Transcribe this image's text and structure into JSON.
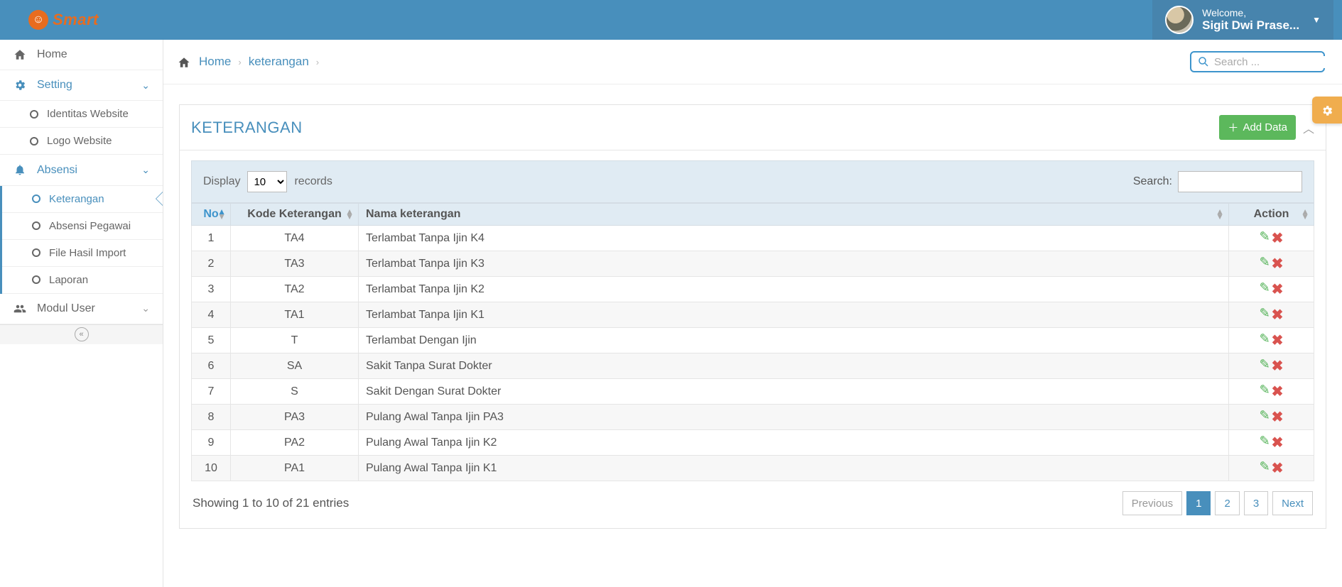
{
  "brand": {
    "name": "Smart"
  },
  "user": {
    "welcome": "Welcome,",
    "name": "Sigit Dwi Prase..."
  },
  "search": {
    "placeholder": "Search ..."
  },
  "sidebar": {
    "home": "Home",
    "setting": {
      "label": "Setting",
      "items": [
        "Identitas Website",
        "Logo Website"
      ]
    },
    "absensi": {
      "label": "Absensi",
      "items": [
        "Keterangan",
        "Absensi Pegawai",
        "File Hasil Import",
        "Laporan"
      ],
      "active_index": 0
    },
    "modul_user": "Modul User"
  },
  "breadcrumb": {
    "home": "Home",
    "page": "keterangan"
  },
  "panel": {
    "title": "KETERANGAN",
    "add_button": "Add Data",
    "display_label_before": "Display",
    "display_label_after": "records",
    "display_value": "10",
    "search_label": "Search:",
    "columns": [
      "No",
      "Kode Keterangan",
      "Nama keterangan",
      "Action"
    ],
    "rows": [
      {
        "no": "1",
        "kode": "TA4",
        "nama": "Terlambat Tanpa Ijin K4"
      },
      {
        "no": "2",
        "kode": "TA3",
        "nama": "Terlambat Tanpa Ijin K3"
      },
      {
        "no": "3",
        "kode": "TA2",
        "nama": "Terlambat Tanpa Ijin K2"
      },
      {
        "no": "4",
        "kode": "TA1",
        "nama": "Terlambat Tanpa Ijin K1"
      },
      {
        "no": "5",
        "kode": "T",
        "nama": "Terlambat Dengan Ijin"
      },
      {
        "no": "6",
        "kode": "SA",
        "nama": "Sakit Tanpa Surat Dokter"
      },
      {
        "no": "7",
        "kode": "S",
        "nama": "Sakit Dengan Surat Dokter"
      },
      {
        "no": "8",
        "kode": "PA3",
        "nama": "Pulang Awal Tanpa Ijin PA3"
      },
      {
        "no": "9",
        "kode": "PA2",
        "nama": "Pulang Awal Tanpa Ijin K2"
      },
      {
        "no": "10",
        "kode": "PA1",
        "nama": "Pulang Awal Tanpa Ijin K1"
      }
    ],
    "info": "Showing 1 to 10 of 21 entries",
    "pager": {
      "previous": "Previous",
      "next": "Next",
      "pages": [
        "1",
        "2",
        "3"
      ],
      "active": "1"
    }
  }
}
